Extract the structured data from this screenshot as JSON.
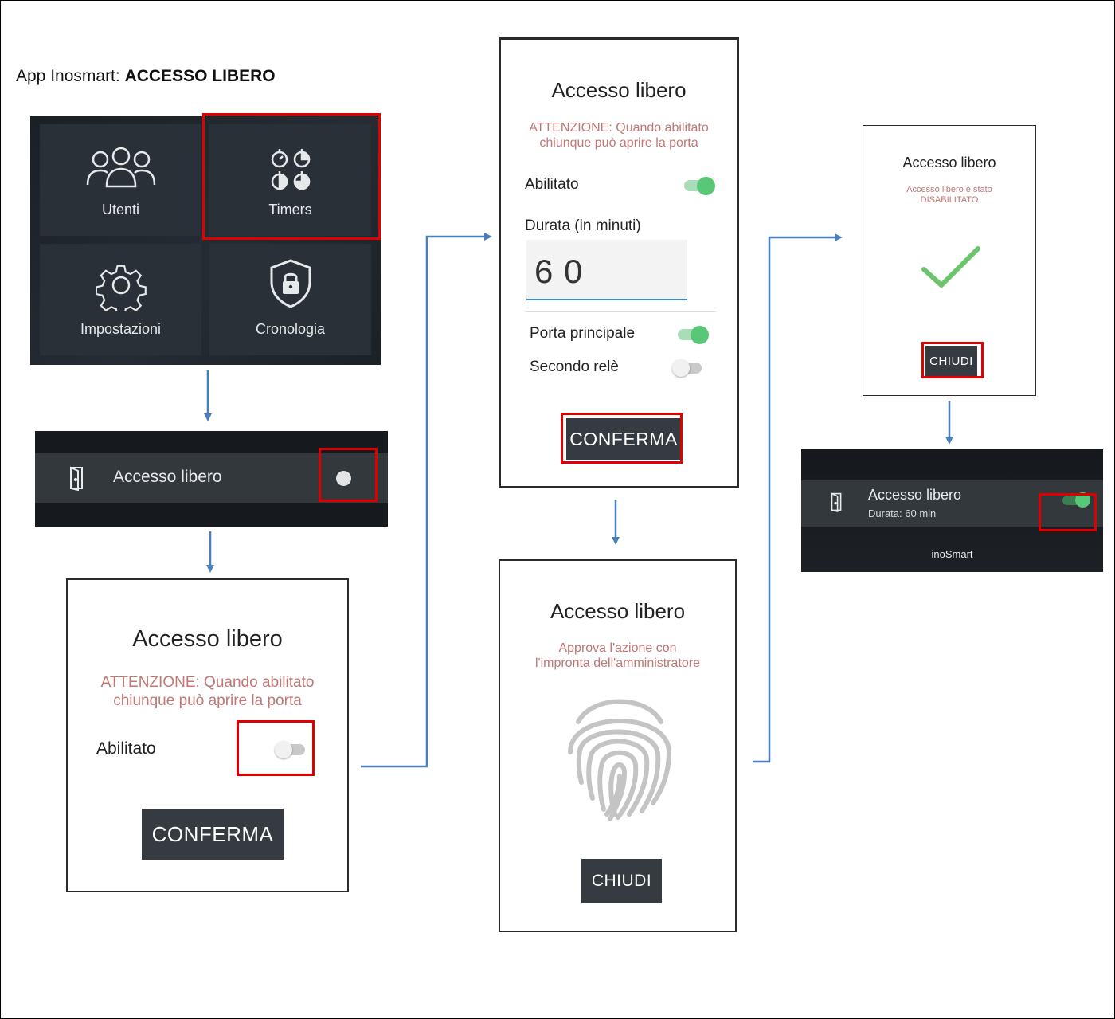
{
  "doc": {
    "title_prefix": "App Inosmart: ",
    "title_bold": "ACCESSO LIBERO"
  },
  "menu": {
    "tiles": [
      {
        "label": "Utenti",
        "icon": "users-icon"
      },
      {
        "label": "Timers",
        "icon": "timers-icon"
      },
      {
        "label": "Impostazioni",
        "icon": "gear-icon"
      },
      {
        "label": "Cronologia",
        "icon": "shield-lock-icon"
      }
    ]
  },
  "row_off": {
    "label": "Accesso libero",
    "icon": "door-icon",
    "toggle_on": false
  },
  "dialog_disabled": {
    "title": "Accesso libero",
    "warning_line1": "ATTENZIONE: Quando abilitato",
    "warning_line2": "chiunque può aprire la porta",
    "enabled_label": "Abilitato",
    "enabled_toggle_on": false,
    "confirm_label": "CONFERMA"
  },
  "dialog_enabled": {
    "title": "Accesso libero",
    "warning_line1": "ATTENZIONE: Quando abilitato",
    "warning_line2": "chiunque può aprire la porta",
    "enabled_label": "Abilitato",
    "enabled_toggle_on": true,
    "duration_label": "Durata (in minuti)",
    "duration_value": "6 0",
    "main_door_label": "Porta principale",
    "main_door_on": true,
    "second_relay_label": "Secondo relè",
    "second_relay_on": false,
    "confirm_label": "CONFERMA"
  },
  "dialog_fingerprint": {
    "title": "Accesso libero",
    "message_line1": "Approva l'azione con",
    "message_line2": "l'impronta dell'amministratore",
    "icon": "fingerprint-icon",
    "close_label": "CHIUDI"
  },
  "dialog_result": {
    "title": "Accesso libero",
    "message_line1": "Accesso libero è stato",
    "message_line2": "DISABILITATO",
    "icon": "checkmark-icon",
    "close_label": "CHIUDI"
  },
  "row_on": {
    "label": "Accesso libero",
    "sublabel": "Durata: 60 min",
    "icon": "door-icon",
    "toggle_on": true,
    "brand": "inoSmart"
  },
  "colors": {
    "highlight": "#e00000",
    "arrow": "#4a7ebb",
    "toggle_on": "#58c878",
    "warning_text": "#c07775",
    "button_dark": "#363b41"
  }
}
